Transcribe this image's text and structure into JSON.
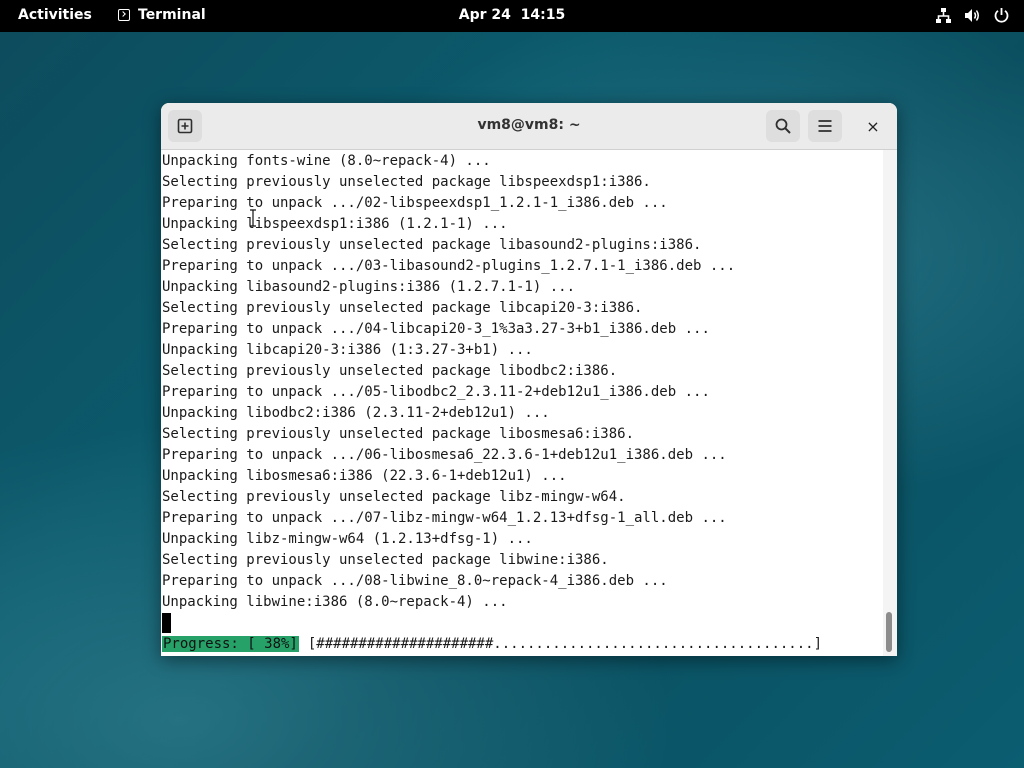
{
  "topbar": {
    "activities": "Activities",
    "app_name": "Terminal",
    "clock": "Apr 24  14:15",
    "tray_icons": [
      "network-icon",
      "volume-icon",
      "power-icon"
    ]
  },
  "window": {
    "title": "vm8@vm8: ~",
    "buttons": {
      "new_tab": "new-tab-icon",
      "search": "search-icon",
      "menu": "hamburger-menu-icon",
      "close": "×"
    }
  },
  "terminal": {
    "lines": [
      "Unpacking fonts-wine (8.0~repack-4) ...",
      "Selecting previously unselected package libspeexdsp1:i386.",
      "Preparing to unpack .../02-libspeexdsp1_1.2.1-1_i386.deb ...",
      "Unpacking libspeexdsp1:i386 (1.2.1-1) ...",
      "Selecting previously unselected package libasound2-plugins:i386.",
      "Preparing to unpack .../03-libasound2-plugins_1.2.7.1-1_i386.deb ...",
      "Unpacking libasound2-plugins:i386 (1.2.7.1-1) ...",
      "Selecting previously unselected package libcapi20-3:i386.",
      "Preparing to unpack .../04-libcapi20-3_1%3a3.27-3+b1_i386.deb ...",
      "Unpacking libcapi20-3:i386 (1:3.27-3+b1) ...",
      "Selecting previously unselected package libodbc2:i386.",
      "Preparing to unpack .../05-libodbc2_2.3.11-2+deb12u1_i386.deb ...",
      "Unpacking libodbc2:i386 (2.3.11-2+deb12u1) ...",
      "Selecting previously unselected package libosmesa6:i386.",
      "Preparing to unpack .../06-libosmesa6_22.3.6-1+deb12u1_i386.deb ...",
      "Unpacking libosmesa6:i386 (22.3.6-1+deb12u1) ...",
      "Selecting previously unselected package libz-mingw-w64.",
      "Preparing to unpack .../07-libz-mingw-w64_1.2.13+dfsg-1_all.deb ...",
      "Unpacking libz-mingw-w64 (1.2.13+dfsg-1) ...",
      "Selecting previously unselected package libwine:i386.",
      "Preparing to unpack .../08-libwine_8.0~repack-4_i386.deb ...",
      "Unpacking libwine:i386 (8.0~repack-4) ..."
    ],
    "progress_label": "Progress: [ 38%]",
    "progress_bar": "[#####################......................................]",
    "progress_percent": 38
  },
  "colors": {
    "progress_highlight": "#26a269",
    "topbar": "#000000",
    "headerbar": "#ebebeb"
  }
}
